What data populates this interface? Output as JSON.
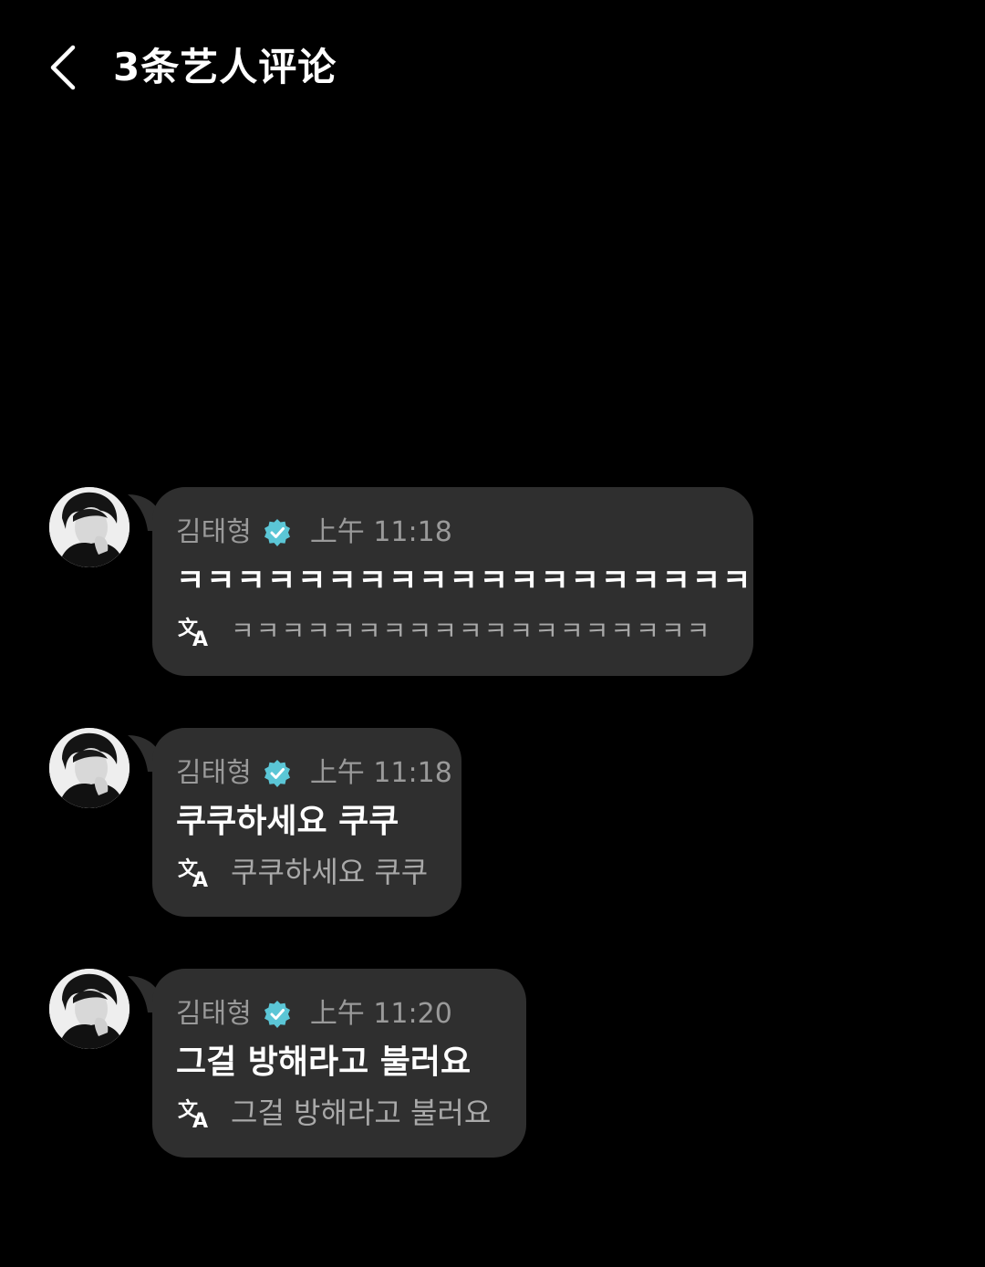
{
  "header": {
    "title": "3条艺人评论",
    "back_icon": "chevron-left-icon"
  },
  "colors": {
    "background": "#000000",
    "bubble": "#2f2f2f",
    "verified": "#5bc6d6",
    "meta_text": "#9a9a9a"
  },
  "comments": [
    {
      "author": "김태형",
      "verified": true,
      "time": "上午 11:18",
      "text": "ㅋㅋㅋㅋㅋㅋㅋㅋㅋㅋㅋㅋㅋㅋㅋㅋㅋㅋㅋ",
      "translation": "ㅋㅋㅋㅋㅋㅋㅋㅋㅋㅋㅋㅋㅋㅋㅋㅋㅋㅋㅋ"
    },
    {
      "author": "김태형",
      "verified": true,
      "time": "上午 11:18",
      "text": "쿠쿠하세요 쿠쿠",
      "translation": "쿠쿠하세요 쿠쿠"
    },
    {
      "author": "김태형",
      "verified": true,
      "time": "上午 11:20",
      "text": "그걸 방해라고 불러요",
      "translation": "그걸 방해라고 불러요"
    }
  ]
}
